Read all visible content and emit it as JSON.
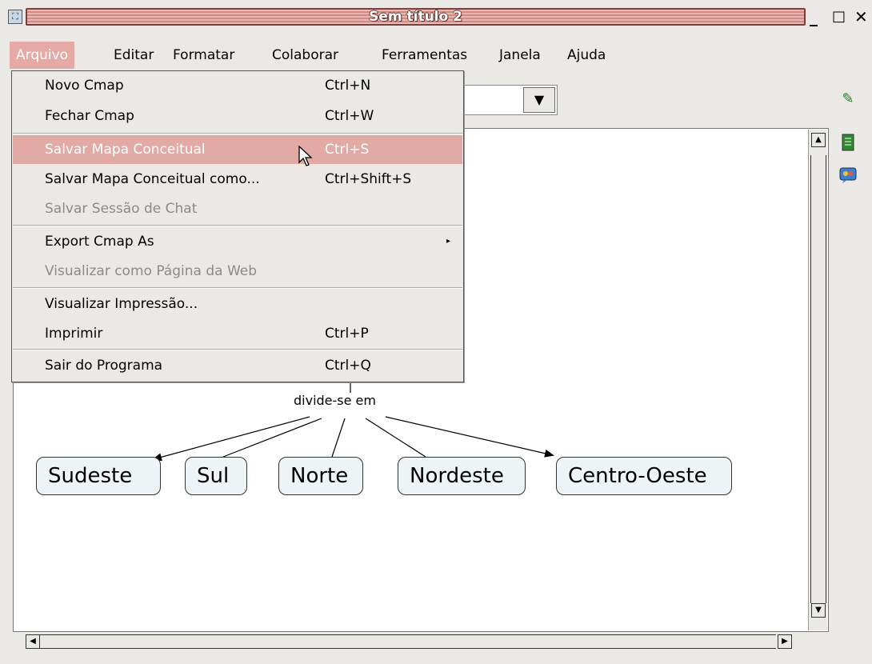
{
  "window": {
    "title": "Sem título 2",
    "app_icon": "cmap-icon",
    "controls": {
      "minimize": "_",
      "maximize": "□",
      "close": "✕"
    }
  },
  "menubar": [
    {
      "label": "Arquivo",
      "active": true
    },
    {
      "label": "Editar"
    },
    {
      "label": "Formatar"
    },
    {
      "label": "Colaborar"
    },
    {
      "label": "Ferramentas"
    },
    {
      "label": "Janela"
    },
    {
      "label": "Ajuda"
    }
  ],
  "file_menu": [
    {
      "label": "Novo Cmap",
      "shortcut": "Ctrl+N"
    },
    {
      "label": "Fechar Cmap",
      "shortcut": "Ctrl+W"
    },
    {
      "label": "Salvar Mapa Conceitual",
      "shortcut": "Ctrl+S",
      "highlighted": true
    },
    {
      "label": "Salvar Mapa Conceitual como...",
      "shortcut": "Ctrl+Shift+S"
    },
    {
      "label": "Salvar Sessão de Chat",
      "shortcut": "",
      "disabled": true
    },
    {
      "label": "Export Cmap As",
      "shortcut": "",
      "submenu": "▸"
    },
    {
      "label": "Visualizar como Página da Web",
      "shortcut": "",
      "disabled": true
    },
    {
      "label": "Visualizar Impressão...",
      "shortcut": ""
    },
    {
      "label": "Imprimir",
      "shortcut": "Ctrl+P"
    },
    {
      "label": "Sair do Programa",
      "shortcut": "Ctrl+Q"
    }
  ],
  "concept_map": {
    "linking_phrase": "divide-se em",
    "concepts": [
      "Sudeste",
      "Sul",
      "Norte",
      "Nordeste",
      "Centro-Oeste"
    ]
  },
  "icons": {
    "toolbar_right": [
      "style-palette-icon",
      "document-icon",
      "collaboration-icon"
    ],
    "combo_arrow": "▼",
    "scroll_up": "▲",
    "scroll_down": "▼",
    "scroll_left": "◀",
    "scroll_right": "▶"
  },
  "colors": {
    "menu_highlight": "#e2aaa6",
    "title_bar": "#d9a09a",
    "node_fill": "#eef4f6"
  }
}
